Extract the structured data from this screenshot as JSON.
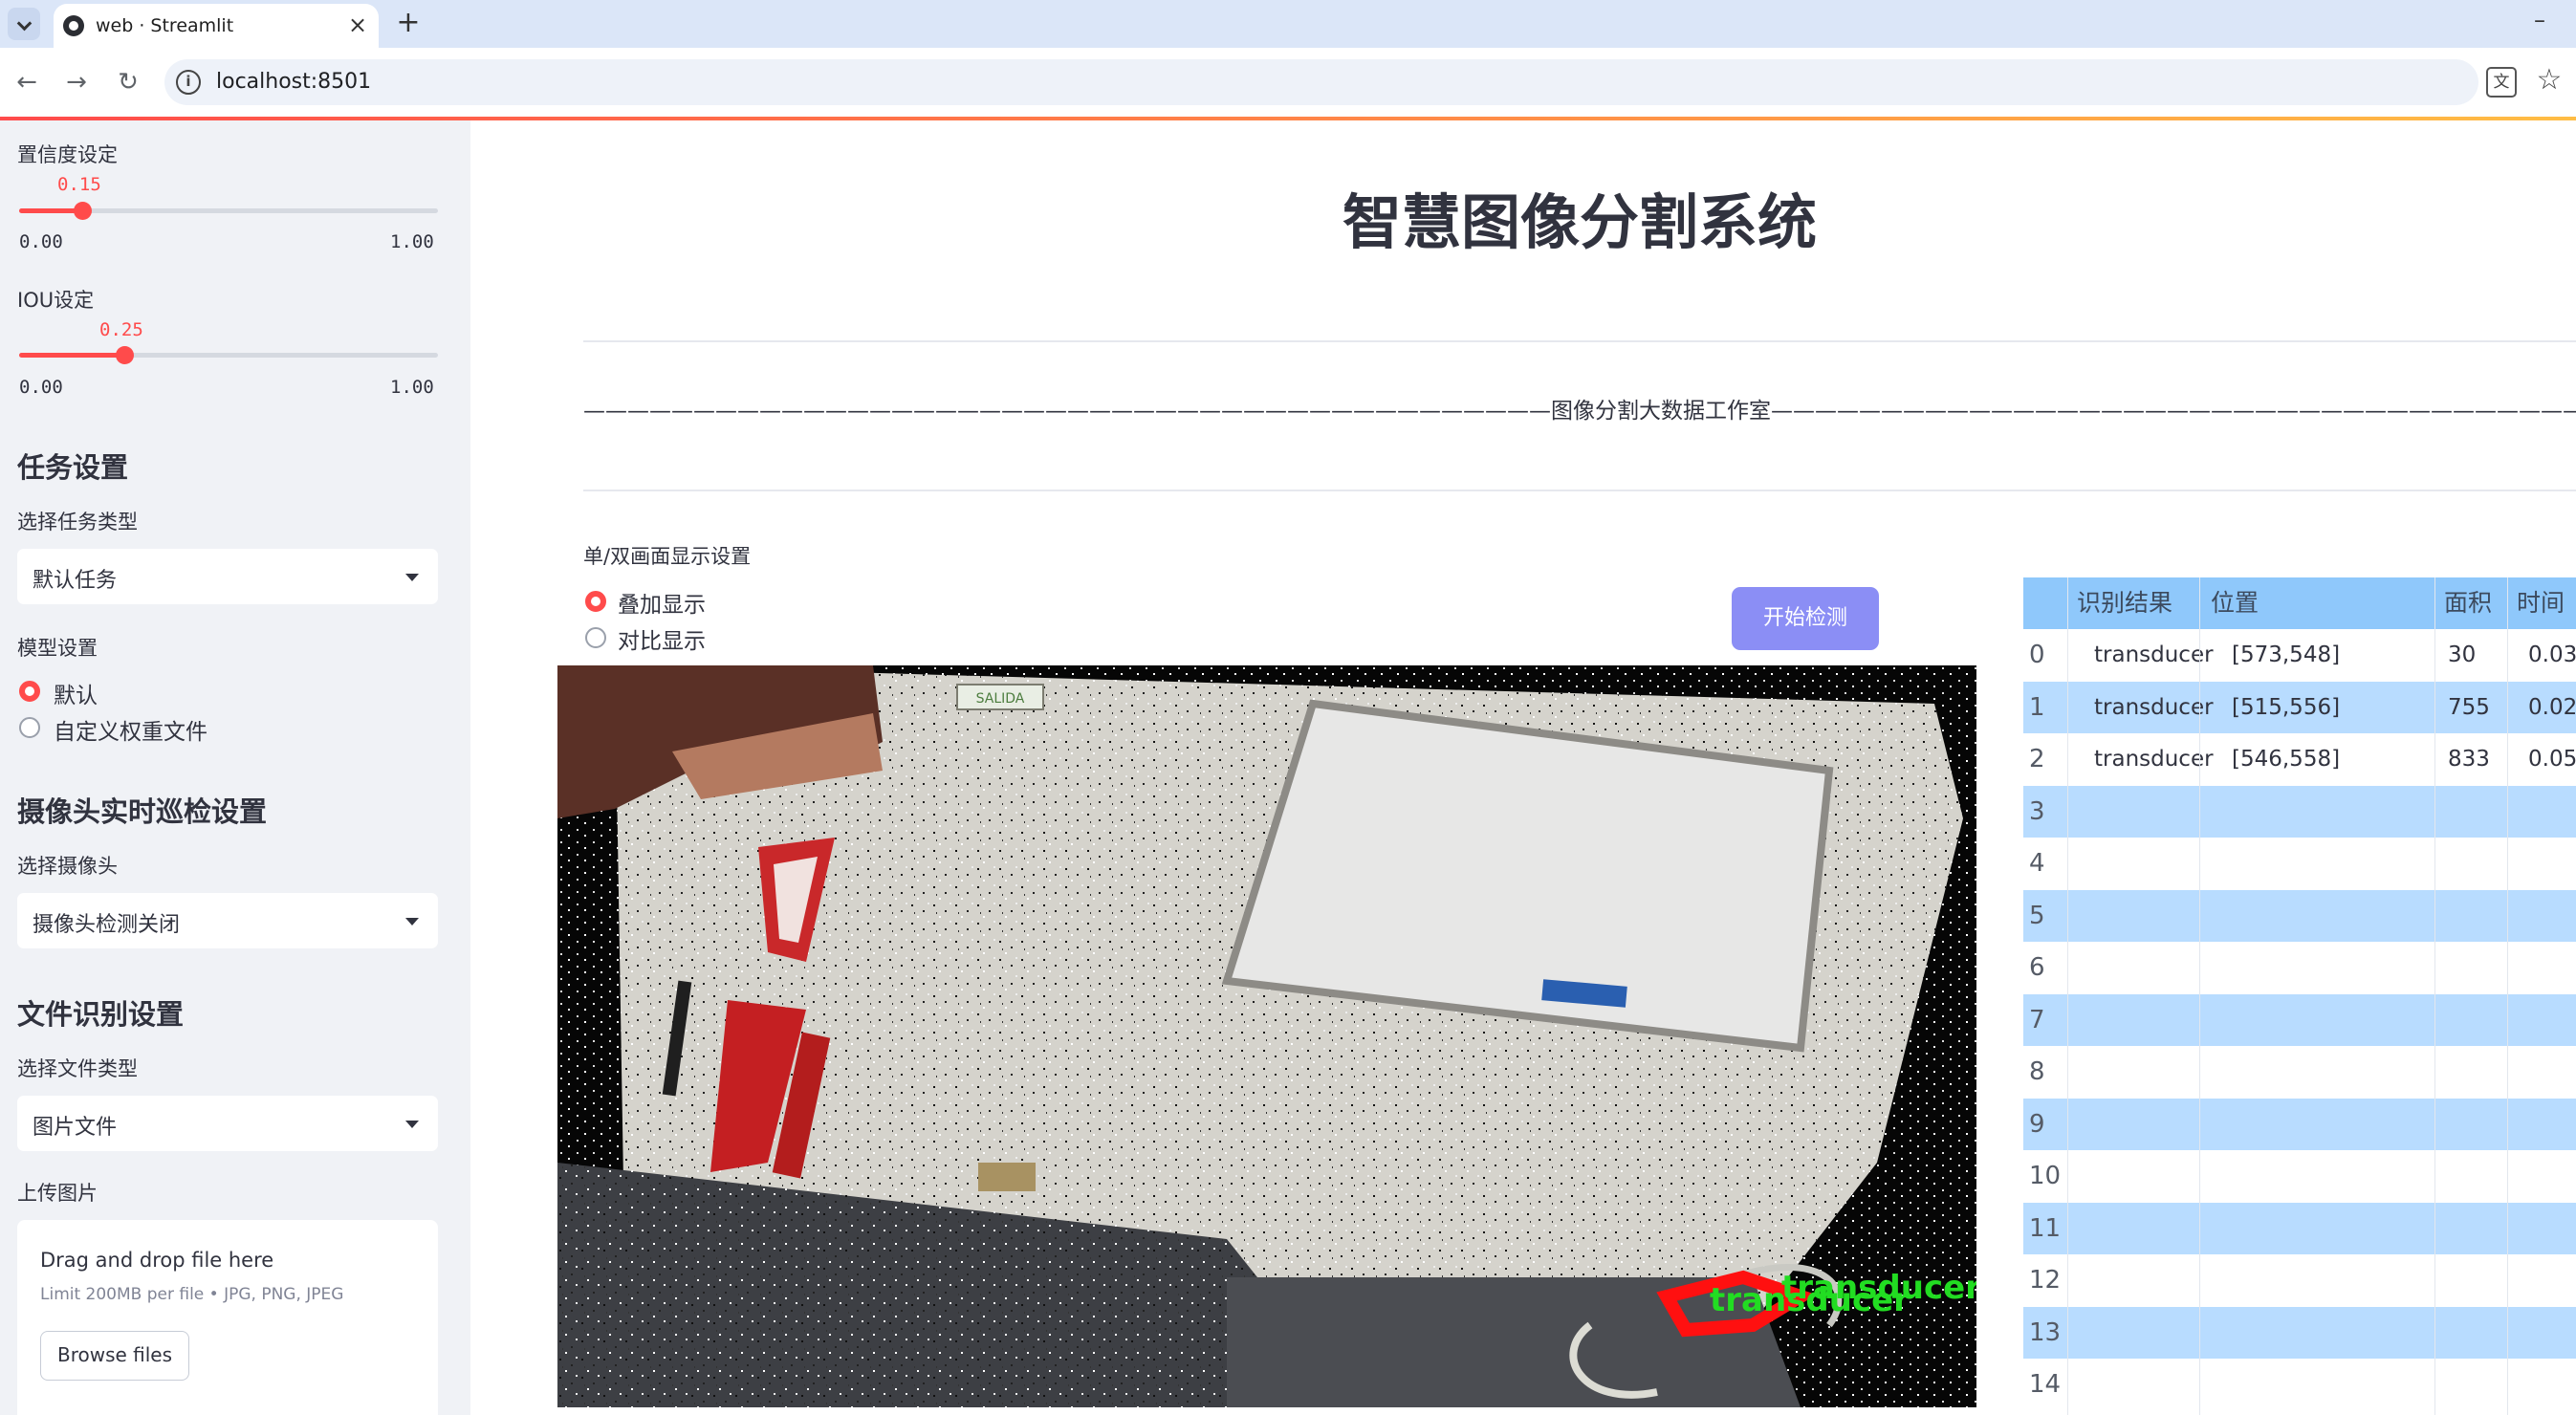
{
  "browser": {
    "tab_title": "web · Streamlit",
    "url": "localhost:8501"
  },
  "sidebar": {
    "confidence": {
      "label": "置信度设定",
      "value_text": "0.15",
      "value": 0.15,
      "min_text": "0.00",
      "max_text": "1.00"
    },
    "iou": {
      "label": "IOU设定",
      "value_text": "0.25",
      "value": 0.25,
      "min_text": "0.00",
      "max_text": "1.00"
    },
    "task": {
      "heading": "任务设置",
      "select_label": "选择任务类型",
      "selected": "默认任务"
    },
    "model": {
      "label": "模型设置",
      "options": [
        "默认",
        "自定义权重文件"
      ],
      "selected_index": 0
    },
    "camera": {
      "heading": "摄像头实时巡检设置",
      "select_label": "选择摄像头",
      "selected": "摄像头检测关闭"
    },
    "file": {
      "heading": "文件识别设置",
      "select_label": "选择文件类型",
      "selected": "图片文件"
    },
    "upload": {
      "label": "上传图片",
      "title": "Drag and drop file here",
      "hint": "Limit 200MB per file • JPG, PNG, JPEG",
      "button": "Browse files"
    }
  },
  "main": {
    "title": "智慧图像分割系统",
    "banner": "————————————————————————————————————————————图像分割大数据工作室——————————————————————————————————————————————",
    "display_label": "单/双画面显示设置",
    "display_options": [
      "叠加显示",
      "对比显示"
    ],
    "display_selected_index": 0,
    "start_button": "开始检测"
  },
  "table": {
    "headers": [
      "识别结果",
      "位置",
      "面积",
      "时间"
    ],
    "rows": [
      {
        "index": "0",
        "cells": [
          "transducer",
          "[573,548]",
          "30",
          "0.03"
        ]
      },
      {
        "index": "1",
        "cells": [
          "transducer",
          "[515,556]",
          "755",
          "0.02"
        ]
      },
      {
        "index": "2",
        "cells": [
          "transducer",
          "[546,558]",
          "833",
          "0.05"
        ]
      },
      {
        "index": "3",
        "cells": [
          "",
          "",
          "",
          ""
        ]
      },
      {
        "index": "4",
        "cells": [
          "",
          "",
          "",
          ""
        ]
      },
      {
        "index": "5",
        "cells": [
          "",
          "",
          "",
          ""
        ]
      },
      {
        "index": "6",
        "cells": [
          "",
          "",
          "",
          ""
        ]
      },
      {
        "index": "7",
        "cells": [
          "",
          "",
          "",
          ""
        ]
      },
      {
        "index": "8",
        "cells": [
          "",
          "",
          "",
          ""
        ]
      },
      {
        "index": "9",
        "cells": [
          "",
          "",
          "",
          ""
        ]
      },
      {
        "index": "10",
        "cells": [
          "",
          "",
          "",
          ""
        ]
      },
      {
        "index": "11",
        "cells": [
          "",
          "",
          "",
          ""
        ]
      },
      {
        "index": "12",
        "cells": [
          "",
          "",
          "",
          ""
        ]
      },
      {
        "index": "13",
        "cells": [
          "",
          "",
          "",
          ""
        ]
      },
      {
        "index": "14",
        "cells": [
          "",
          "",
          "",
          ""
        ]
      }
    ]
  },
  "image": {
    "overlay_label": "transducer",
    "fire_sign_text": "SALIDA"
  },
  "colors": {
    "accent": "#ff4b4b",
    "button": "#8b8ef5",
    "table_header": "#8fc8fb",
    "table_alt": "#b8dcff",
    "sidebar_bg": "#f0f2f6"
  }
}
